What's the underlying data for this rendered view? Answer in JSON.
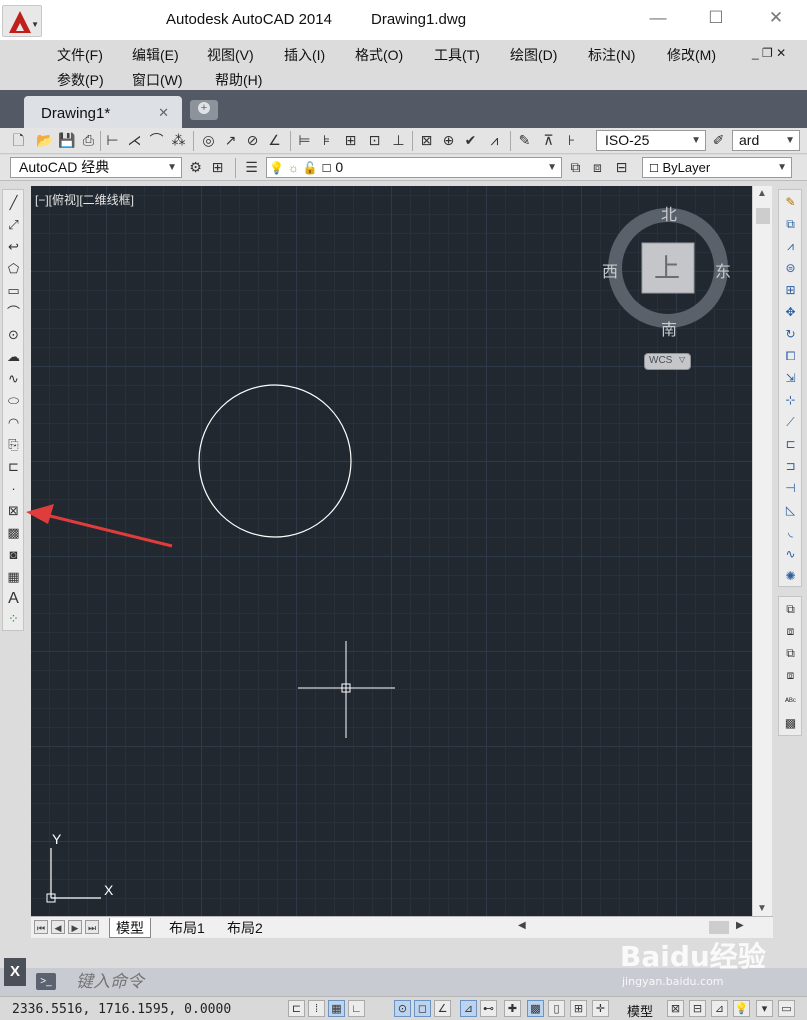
{
  "window": {
    "app_title": "Autodesk AutoCAD 2014",
    "file_title": "Drawing1.dwg",
    "minimize": "—",
    "maximize": "☐",
    "close": "✕"
  },
  "menu": {
    "row1": [
      "文件(F)",
      "编辑(E)",
      "视图(V)",
      "插入(I)",
      "格式(O)",
      "工具(T)",
      "绘图(D)",
      "标注(N)",
      "修改(M)"
    ],
    "row2": [
      "参数(P)",
      "窗口(W)",
      "帮助(H)"
    ],
    "mdi_controls": "_ ❐ ✕"
  },
  "tabs": {
    "document": "Drawing1*",
    "close": "✕"
  },
  "toolbar": {
    "dimstyle": "ISO-25",
    "textstyle": "ard",
    "workspace": "AutoCAD 经典",
    "layer": "0",
    "color": "ByLayer"
  },
  "viewport": {
    "label": "[−][俯视][二维线框]",
    "viewcube": {
      "north": "北",
      "south": "南",
      "east": "东",
      "west": "西",
      "face": "上",
      "wcs": "WCS"
    },
    "ucs": {
      "x": "X",
      "y": "Y"
    }
  },
  "layout_tabs": [
    "模型",
    "布局1",
    "布局2"
  ],
  "command": {
    "placeholder": "键入命令",
    "close": "X",
    "prompt_icon": ">_"
  },
  "status": {
    "coordinates": "2336.5516, 1716.1595, 0.0000",
    "model": "模型"
  },
  "watermark": {
    "brand": "Baidu经验",
    "url": "jingyan.baidu.com"
  },
  "colors": {
    "canvas_bg": "#212830",
    "tab_bar": "#535a66",
    "annotation_arrow": "#e03c3c",
    "logo_red": "#c0201c"
  }
}
